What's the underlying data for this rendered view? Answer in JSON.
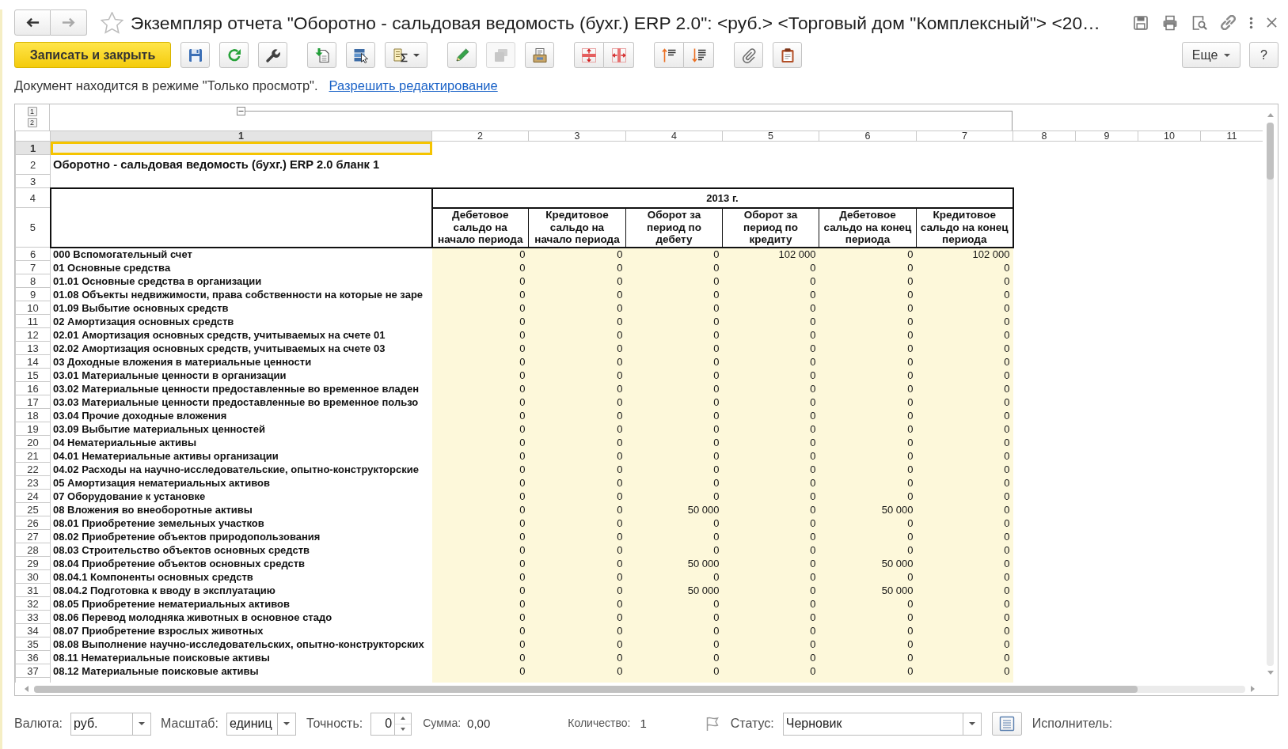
{
  "window": {
    "title": "Экземпляр отчета \"Оборотно - сальдовая ведомость (бухг.) ERP 2.0\": <руб.> <Торговый дом \"Комплексный\"> <20…",
    "favorite": false,
    "navigation": [
      {
        "kind": "back",
        "disabled": false
      },
      {
        "kind": "forward",
        "disabled": true
      }
    ],
    "actions": [
      {
        "kind": "save"
      },
      {
        "kind": "print"
      },
      {
        "kind": "preview"
      },
      {
        "kind": "link"
      },
      {
        "kind": "more"
      },
      {
        "kind": "close"
      }
    ]
  },
  "toolbar": {
    "primary_button": "Записать и закрыть",
    "groups": [
      {
        "joined": false,
        "tools": [
          {
            "kind": "save",
            "disabled": false
          },
          {
            "kind": "refresh",
            "disabled": false
          },
          {
            "kind": "wrench",
            "disabled": false
          }
        ]
      },
      {
        "joined": false,
        "tools": [
          {
            "kind": "import",
            "disabled": false
          },
          {
            "kind": "table",
            "disabled": false
          },
          {
            "kind": "sum",
            "disabled": false
          }
        ]
      },
      {
        "joined": false,
        "tools": [
          {
            "kind": "pencil",
            "disabled": false
          },
          {
            "kind": "stack",
            "disabled": true
          },
          {
            "kind": "tray",
            "disabled": false
          }
        ]
      },
      {
        "joined": true,
        "tools": [
          {
            "kind": "expand",
            "disabled": false
          },
          {
            "kind": "collapse",
            "disabled": false
          }
        ]
      },
      {
        "joined": true,
        "tools": [
          {
            "kind": "ascending",
            "disabled": false
          },
          {
            "kind": "descending",
            "disabled": false
          }
        ]
      },
      {
        "joined": false,
        "tools": [
          {
            "kind": "clip",
            "disabled": false
          },
          {
            "kind": "clipboard",
            "disabled": false
          }
        ]
      }
    ],
    "more_button": "Еще",
    "help_button": "?"
  },
  "notice": {
    "text": "Документ находится в режиме \"Только просмотр\".",
    "link": "Разрешить редактирование"
  },
  "sheet": {
    "group_levels": [
      "1",
      "2"
    ],
    "column_numbers": [
      {
        "label": "1",
        "selected": true
      },
      {
        "label": "2",
        "selected": false
      },
      {
        "label": "3",
        "selected": false
      },
      {
        "label": "4",
        "selected": false
      },
      {
        "label": "5",
        "selected": false
      },
      {
        "label": "6",
        "selected": false
      },
      {
        "label": "7",
        "selected": false
      },
      {
        "label": "8",
        "selected": false
      },
      {
        "label": "9",
        "selected": false
      },
      {
        "label": "10",
        "selected": false
      },
      {
        "label": "11",
        "selected": false
      }
    ],
    "rows": [
      {
        "kind": "blank",
        "number": "1",
        "selected": true
      },
      {
        "kind": "title",
        "number": "2",
        "selected": false,
        "text": "Оборотно - сальдовая ведомость (бухг.) ERP 2.0 бланк 1"
      },
      {
        "kind": "blank",
        "number": "3",
        "selected": false
      },
      {
        "kind": "period",
        "number": "4",
        "selected": false,
        "text": "2013 г."
      },
      {
        "kind": "headings",
        "number": "5",
        "selected": false,
        "cells": [
          "Дебетовое сальдо на начало периода",
          "Кредитовое сальдо на начало периода",
          "Оборот за период по дебету",
          "Оборот за период по кредиту",
          "Дебетовое сальдо на конец периода",
          "Кредитовое сальдо на конец периода"
        ]
      },
      {
        "kind": "account",
        "number": "6",
        "selected": false,
        "text": "000 Вспомогательный счет",
        "values": [
          "0",
          "0",
          "0",
          "102 000",
          "0",
          "102 000"
        ]
      },
      {
        "kind": "account",
        "number": "7",
        "selected": false,
        "text": "01 Основные средства",
        "values": [
          "0",
          "0",
          "0",
          "0",
          "0",
          "0"
        ]
      },
      {
        "kind": "account",
        "number": "8",
        "selected": false,
        "text": "01.01 Основные средства в организации",
        "values": [
          "0",
          "0",
          "0",
          "0",
          "0",
          "0"
        ]
      },
      {
        "kind": "account",
        "number": "9",
        "selected": false,
        "text": "01.08 Объекты недвижимости, права собственности на которые не заре",
        "values": [
          "0",
          "0",
          "0",
          "0",
          "0",
          "0"
        ]
      },
      {
        "kind": "account",
        "number": "10",
        "selected": false,
        "text": "01.09 Выбытие основных средств",
        "values": [
          "0",
          "0",
          "0",
          "0",
          "0",
          "0"
        ]
      },
      {
        "kind": "account",
        "number": "11",
        "selected": false,
        "text": "02 Амортизация основных средств",
        "values": [
          "0",
          "0",
          "0",
          "0",
          "0",
          "0"
        ]
      },
      {
        "kind": "account",
        "number": "12",
        "selected": false,
        "text": "02.01 Амортизация основных средств, учитываемых на счете 01",
        "values": [
          "0",
          "0",
          "0",
          "0",
          "0",
          "0"
        ]
      },
      {
        "kind": "account",
        "number": "13",
        "selected": false,
        "text": "02.02 Амортизация основных средств, учитываемых на счете 03",
        "values": [
          "0",
          "0",
          "0",
          "0",
          "0",
          "0"
        ]
      },
      {
        "kind": "account",
        "number": "14",
        "selected": false,
        "text": "03 Доходные вложения в материальные ценности",
        "values": [
          "0",
          "0",
          "0",
          "0",
          "0",
          "0"
        ]
      },
      {
        "kind": "account",
        "number": "15",
        "selected": false,
        "text": "03.01 Материальные ценности в организации",
        "values": [
          "0",
          "0",
          "0",
          "0",
          "0",
          "0"
        ]
      },
      {
        "kind": "account",
        "number": "16",
        "selected": false,
        "text": "03.02 Материальные ценности предоставленные во временное владен",
        "values": [
          "0",
          "0",
          "0",
          "0",
          "0",
          "0"
        ]
      },
      {
        "kind": "account",
        "number": "17",
        "selected": false,
        "text": "03.03 Материальные ценности предоставленные во временное пользо",
        "values": [
          "0",
          "0",
          "0",
          "0",
          "0",
          "0"
        ]
      },
      {
        "kind": "account",
        "number": "18",
        "selected": false,
        "text": "03.04 Прочие доходные вложения",
        "values": [
          "0",
          "0",
          "0",
          "0",
          "0",
          "0"
        ]
      },
      {
        "kind": "account",
        "number": "19",
        "selected": false,
        "text": "03.09 Выбытие материальных ценностей",
        "values": [
          "0",
          "0",
          "0",
          "0",
          "0",
          "0"
        ]
      },
      {
        "kind": "account",
        "number": "20",
        "selected": false,
        "text": "04 Нематериальные активы",
        "values": [
          "0",
          "0",
          "0",
          "0",
          "0",
          "0"
        ]
      },
      {
        "kind": "account",
        "number": "21",
        "selected": false,
        "text": "04.01 Нематериальные активы организации",
        "values": [
          "0",
          "0",
          "0",
          "0",
          "0",
          "0"
        ]
      },
      {
        "kind": "account",
        "number": "22",
        "selected": false,
        "text": "04.02 Расходы на научно-исследовательские, опытно-конструкторские",
        "values": [
          "0",
          "0",
          "0",
          "0",
          "0",
          "0"
        ]
      },
      {
        "kind": "account",
        "number": "23",
        "selected": false,
        "text": "05 Амортизация нематериальных активов",
        "values": [
          "0",
          "0",
          "0",
          "0",
          "0",
          "0"
        ]
      },
      {
        "kind": "account",
        "number": "24",
        "selected": false,
        "text": "07 Оборудование к установке",
        "values": [
          "0",
          "0",
          "0",
          "0",
          "0",
          "0"
        ]
      },
      {
        "kind": "account",
        "number": "25",
        "selected": false,
        "text": "08 Вложения во внеоборотные активы",
        "values": [
          "0",
          "0",
          "50 000",
          "0",
          "50 000",
          "0"
        ]
      },
      {
        "kind": "account",
        "number": "26",
        "selected": false,
        "text": "08.01 Приобретение земельных участков",
        "values": [
          "0",
          "0",
          "0",
          "0",
          "0",
          "0"
        ]
      },
      {
        "kind": "account",
        "number": "27",
        "selected": false,
        "text": "08.02 Приобретение объектов природопользования",
        "values": [
          "0",
          "0",
          "0",
          "0",
          "0",
          "0"
        ]
      },
      {
        "kind": "account",
        "number": "28",
        "selected": false,
        "text": "08.03 Строительство объектов основных средств",
        "values": [
          "0",
          "0",
          "0",
          "0",
          "0",
          "0"
        ]
      },
      {
        "kind": "account",
        "number": "29",
        "selected": false,
        "text": "08.04 Приобретение объектов основных средств",
        "values": [
          "0",
          "0",
          "50 000",
          "0",
          "50 000",
          "0"
        ]
      },
      {
        "kind": "account",
        "number": "30",
        "selected": false,
        "text": "08.04.1 Компоненты основных средств",
        "values": [
          "0",
          "0",
          "0",
          "0",
          "0",
          "0"
        ]
      },
      {
        "kind": "account",
        "number": "31",
        "selected": false,
        "text": "08.04.2 Подготовка к вводу в эксплуатацию",
        "values": [
          "0",
          "0",
          "50 000",
          "0",
          "50 000",
          "0"
        ]
      },
      {
        "kind": "account",
        "number": "32",
        "selected": false,
        "text": "08.05 Приобретение нематериальных активов",
        "values": [
          "0",
          "0",
          "0",
          "0",
          "0",
          "0"
        ]
      },
      {
        "kind": "account",
        "number": "33",
        "selected": false,
        "text": "08.06 Перевод молодняка животных в основное стадо",
        "values": [
          "0",
          "0",
          "0",
          "0",
          "0",
          "0"
        ]
      },
      {
        "kind": "account",
        "number": "34",
        "selected": false,
        "text": "08.07 Приобретение взрослых животных",
        "values": [
          "0",
          "0",
          "0",
          "0",
          "0",
          "0"
        ]
      },
      {
        "kind": "account",
        "number": "35",
        "selected": false,
        "text": "08.08 Выполнение научно-исследовательских, опытно-конструкторских",
        "values": [
          "0",
          "0",
          "0",
          "0",
          "0",
          "0"
        ]
      },
      {
        "kind": "account",
        "number": "36",
        "selected": false,
        "text": "08.11 Нематериальные поисковые активы",
        "values": [
          "0",
          "0",
          "0",
          "0",
          "0",
          "0"
        ]
      },
      {
        "kind": "account",
        "number": "37",
        "selected": false,
        "text": "08.12 Материальные поисковые активы",
        "values": [
          "0",
          "0",
          "0",
          "0",
          "0",
          "0"
        ]
      }
    ]
  },
  "footer": {
    "currency": {
      "label": "Валюта:",
      "value": "руб."
    },
    "scale": {
      "label": "Масштаб:",
      "value": "единиц"
    },
    "precision": {
      "label": "Точность:",
      "value": "0"
    },
    "sum": {
      "label": "Сумма:",
      "value": "0,00"
    },
    "count": {
      "label": "Количество:",
      "value": "1"
    },
    "status": {
      "label": "Статус:",
      "value": "Черновик"
    },
    "executor": {
      "label": "Исполнитель:"
    }
  }
}
